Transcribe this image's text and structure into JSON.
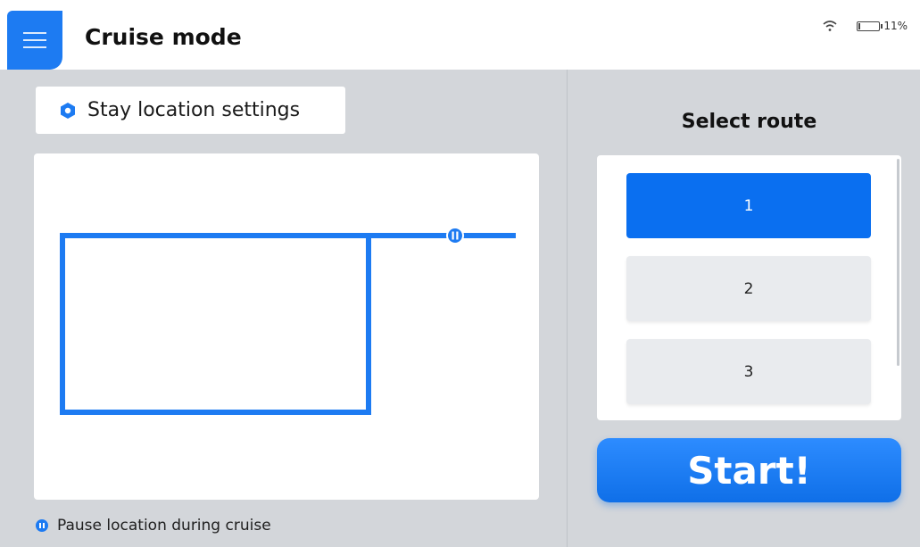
{
  "header": {
    "title": "Cruise mode",
    "menu_icon": "hamburger-menu-icon",
    "wifi_icon": "wifi-icon",
    "battery_icon": "battery-icon",
    "battery_percent": "11%",
    "battery_level": 0.11
  },
  "left_panel": {
    "stay_button_label": "Stay location settings",
    "stay_button_icon": "hexagon-settings-icon",
    "legend_icon": "pause-location-icon",
    "legend_label": "Pause location during cruise"
  },
  "right_panel": {
    "title": "Select route",
    "routes": [
      {
        "label": "1",
        "selected": true
      },
      {
        "label": "2",
        "selected": false
      },
      {
        "label": "3",
        "selected": false
      }
    ],
    "start_label": "Start!"
  },
  "colors": {
    "accent": "#1d7bf2",
    "selected_route": "#0a6ff0",
    "panel_background": "#d3d6da",
    "card_background": "#ffffff"
  }
}
